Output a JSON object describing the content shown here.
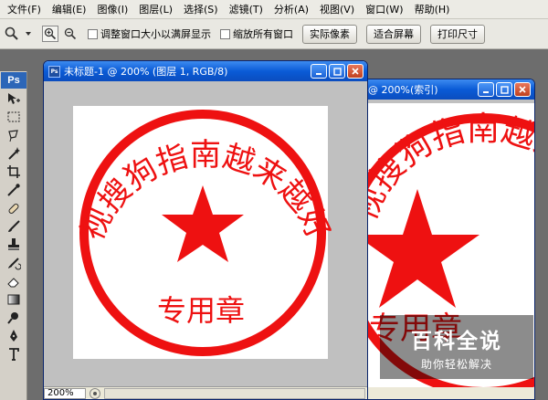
{
  "menus": [
    "文件(F)",
    "编辑(E)",
    "图像(I)",
    "图层(L)",
    "选择(S)",
    "滤镜(T)",
    "分析(A)",
    "视图(V)",
    "窗口(W)",
    "帮助(H)"
  ],
  "options_bar": {
    "resize_windows_label": "调整窗口大小以满屏显示",
    "zoom_all_label": "缩放所有窗口",
    "actual_pixels_label": "实际像素",
    "fit_screen_label": "适合屏幕",
    "print_size_label": "打印尺寸"
  },
  "toolbox": {
    "logo": "Ps",
    "tools": [
      "move-icon",
      "marquee-icon",
      "lasso-icon",
      "magic-wand-icon",
      "crop-icon",
      "eyedropper-icon",
      "healing-icon",
      "brush-icon",
      "stamp-icon",
      "history-brush-icon",
      "eraser-icon",
      "gradient-icon",
      "burn-icon",
      "pen-icon",
      "type-icon"
    ]
  },
  "doc1": {
    "title": "未标题-1 @ 200% (图层 1, RGB/8)",
    "zoom": "200%"
  },
  "doc2": {
    "title_partial": "@ 200%(索引)"
  },
  "seal": {
    "ring_text": "视搜狗指南越来越好",
    "bottom_text": "专用章",
    "color": "#ee1111"
  },
  "watermark": {
    "title": "百科全说",
    "subtitle": "助你轻松解决"
  }
}
